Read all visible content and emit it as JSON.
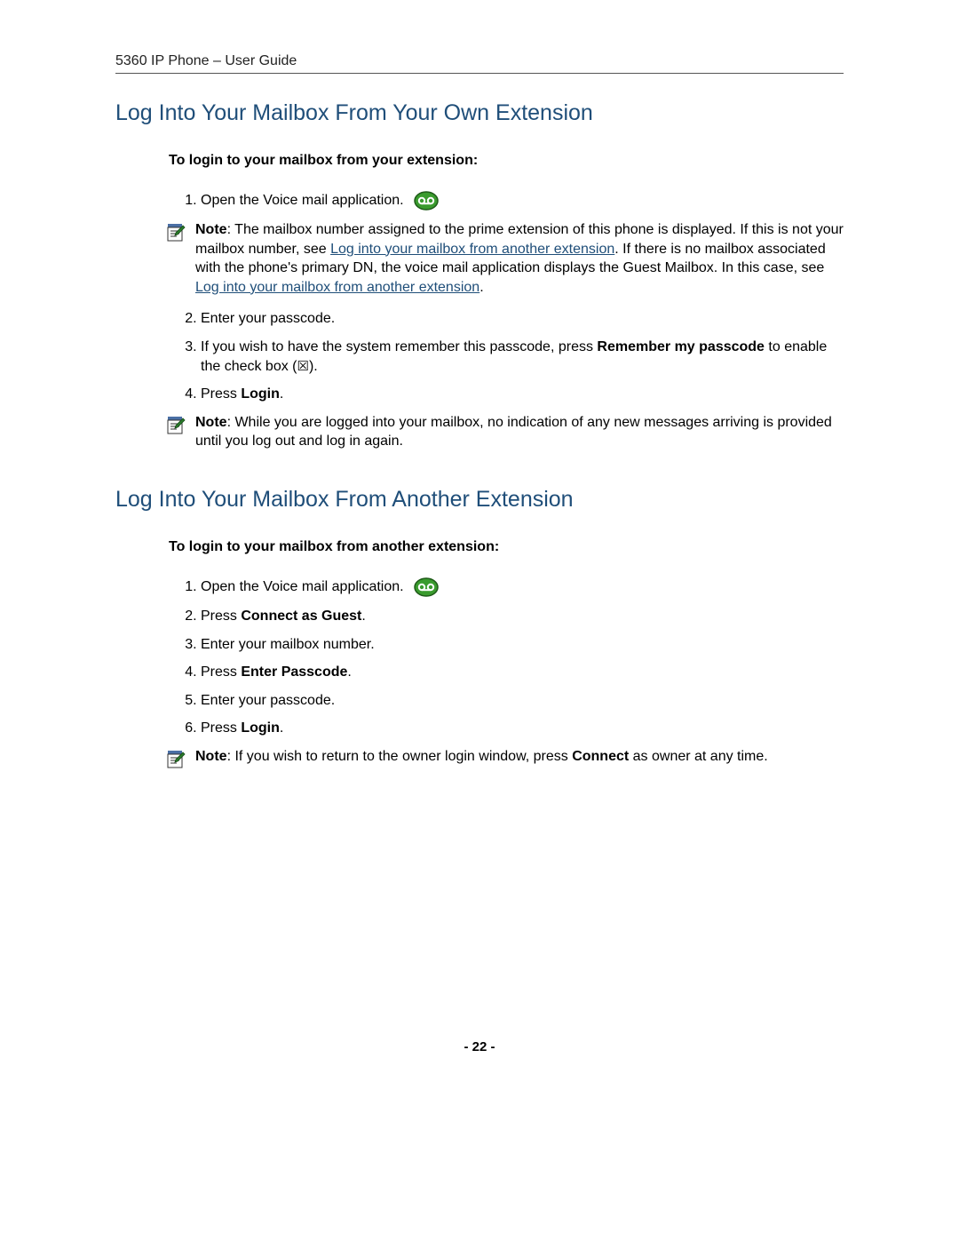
{
  "header": "5360 IP Phone – User Guide",
  "footer": "- 22 -",
  "section1": {
    "heading": "Log Into Your Mailbox From Your Own Extension",
    "subhead": "To login to your mailbox from your extension:",
    "step1": "Open the Voice mail application.",
    "note1_label": "Note",
    "note1_a": ": The mailbox number assigned to the prime extension of this phone is displayed. If this is not your mailbox number, see ",
    "note1_link1": "Log into your mailbox from another extension",
    "note1_b": ". If there is no mailbox associated with the phone's primary DN, the voice mail application displays the Guest Mailbox. In this case, see ",
    "note1_link2": "Log into your mailbox from another extension",
    "note1_c": ".",
    "step2": "Enter your passcode.",
    "step3_a": "If you wish to have the system remember this passcode, press ",
    "step3_bold": "Remember my passcode",
    "step3_b": " to enable the check box (",
    "step3_c": ").",
    "step4_a": "Press ",
    "step4_bold": "Login",
    "step4_b": ".",
    "note2_label": "Note",
    "note2_text": ": While you are logged into your mailbox, no indication of any new messages arriving is provided until you log out and log in again."
  },
  "section2": {
    "heading": "Log Into Your Mailbox From Another Extension",
    "subhead": "To login to your mailbox from another extension:",
    "step1": "Open the Voice mail application.",
    "step2_a": "Press ",
    "step2_bold": "Connect as Guest",
    "step2_b": ".",
    "step3": "Enter your mailbox number.",
    "step4_a": "Press ",
    "step4_bold": "Enter Passcode",
    "step4_b": ".",
    "step5": "Enter your passcode.",
    "step6_a": "Press ",
    "step6_bold": "Login",
    "step6_b": ".",
    "note_label": "Note",
    "note_a": ": If you wish to return to the owner login window, press ",
    "note_bold": "Connect",
    "note_b": " as owner at any time."
  }
}
